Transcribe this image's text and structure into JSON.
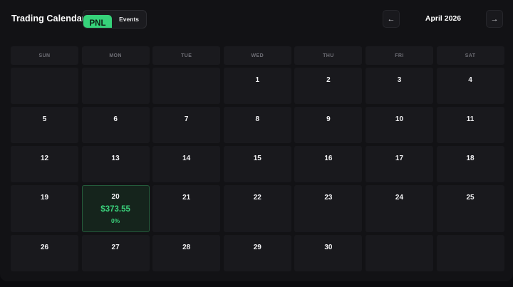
{
  "header": {
    "title": "Trading Calendar",
    "toggle": {
      "pnl_label": "PNL",
      "events_label": "Events",
      "selected": "PNL"
    },
    "prev_label": "←",
    "next_label": "→",
    "month_label": "April 2026"
  },
  "weekdays": [
    "SUN",
    "MON",
    "TUE",
    "WED",
    "THU",
    "FRI",
    "SAT"
  ],
  "weeks": [
    [
      "",
      "",
      "",
      "1",
      "2",
      "3",
      "4"
    ],
    [
      "5",
      "6",
      "7",
      "8",
      "9",
      "10",
      "11"
    ],
    [
      "12",
      "13",
      "14",
      "15",
      "16",
      "17",
      "18"
    ],
    [
      "19",
      "20",
      "21",
      "22",
      "23",
      "24",
      "25"
    ],
    [
      "26",
      "27",
      "28",
      "29",
      "30",
      "",
      ""
    ]
  ],
  "highlight": {
    "day": "20",
    "pnl": "$373.55",
    "pct": "0%"
  },
  "colors": {
    "accent_green": "#36d27a",
    "background": "#121215",
    "cell": "#19191d"
  }
}
